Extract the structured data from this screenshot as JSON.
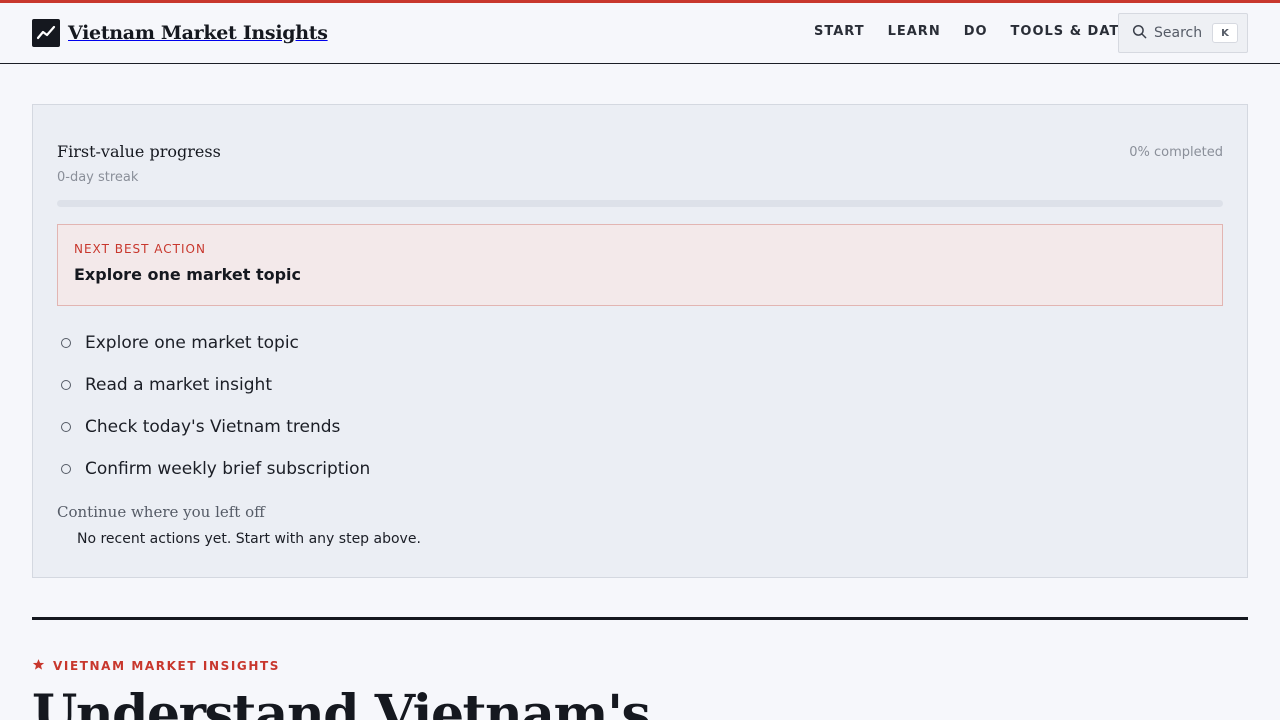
{
  "brand": {
    "name": "Vietnam Market Insights",
    "logo_icon": "trend-chart-icon",
    "accent": "#c8372d"
  },
  "nav": {
    "items": [
      "START",
      "LEARN",
      "DO",
      "TOOLS & DATA"
    ]
  },
  "search": {
    "label": "Search",
    "shortcut": "K",
    "icon": "search-icon"
  },
  "progress": {
    "title": "First-value progress",
    "streak": "0-day streak",
    "percent_text": "0% completed",
    "percent": 0
  },
  "next_action": {
    "label": "NEXT BEST ACTION",
    "title": "Explore one market topic"
  },
  "steps": [
    {
      "label": "Explore one market topic",
      "done": false
    },
    {
      "label": "Read a market insight",
      "done": false
    },
    {
      "label": "Check today's Vietnam trends",
      "done": false
    },
    {
      "label": "Confirm weekly brief subscription",
      "done": false
    }
  ],
  "continue": {
    "title": "Continue where you left off",
    "empty": "No recent actions yet. Start with any step above."
  },
  "hero": {
    "eyebrow": "VIETNAM MARKET INSIGHTS",
    "heading": "Understand Vietnam's"
  }
}
